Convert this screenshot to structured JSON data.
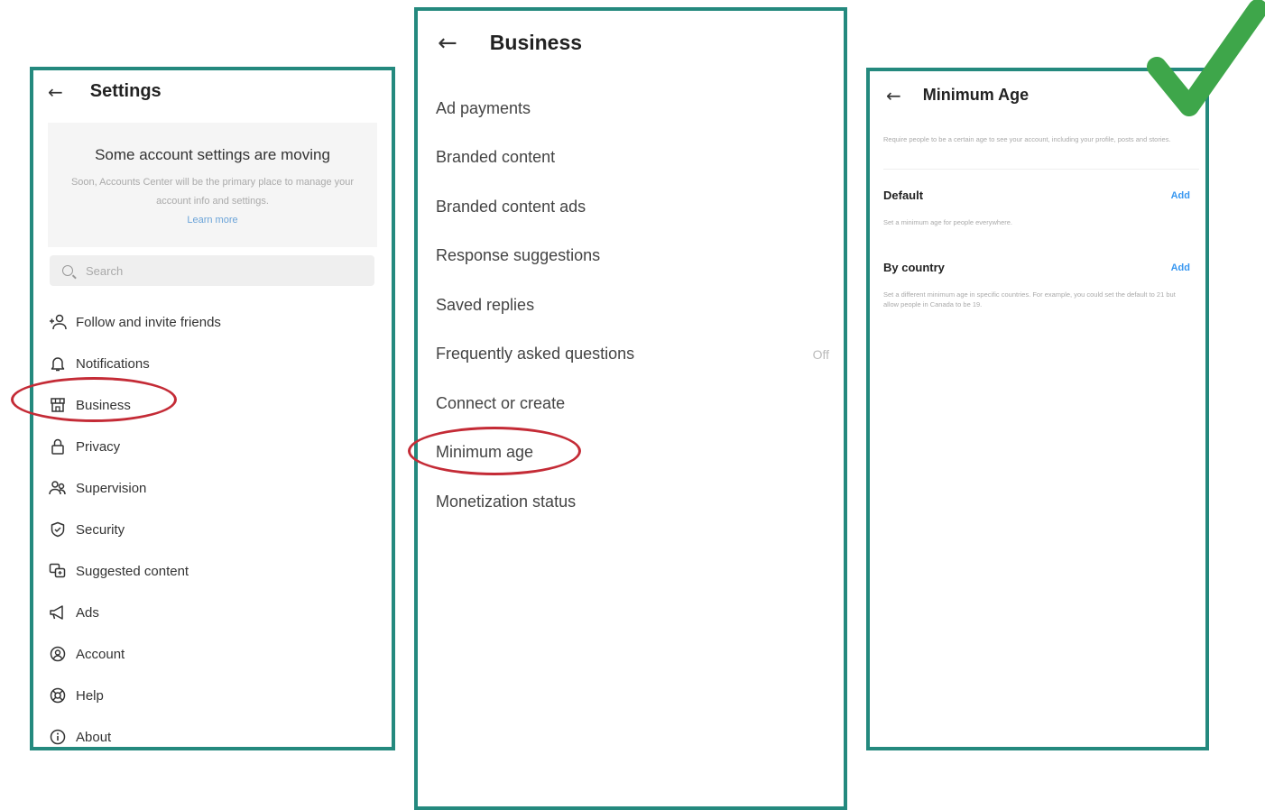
{
  "settings": {
    "title": "Settings",
    "notice": {
      "title": "Some account settings are moving",
      "body": "Soon, Accounts Center will be the primary place to manage your account info and settings.",
      "link": "Learn more"
    },
    "search_placeholder": "Search",
    "items": [
      {
        "label": "Follow and invite friends",
        "icon": "add-person-icon"
      },
      {
        "label": "Notifications",
        "icon": "bell-icon"
      },
      {
        "label": "Business",
        "icon": "store-icon"
      },
      {
        "label": "Privacy",
        "icon": "lock-icon"
      },
      {
        "label": "Supervision",
        "icon": "people-icon"
      },
      {
        "label": "Security",
        "icon": "shield-icon"
      },
      {
        "label": "Suggested content",
        "icon": "suggested-content-icon"
      },
      {
        "label": "Ads",
        "icon": "megaphone-icon"
      },
      {
        "label": "Account",
        "icon": "account-icon"
      },
      {
        "label": "Help",
        "icon": "lifebuoy-icon"
      },
      {
        "label": "About",
        "icon": "info-icon"
      }
    ]
  },
  "business": {
    "title": "Business",
    "items": [
      {
        "label": "Ad payments",
        "value": ""
      },
      {
        "label": "Branded content",
        "value": ""
      },
      {
        "label": "Branded content ads",
        "value": ""
      },
      {
        "label": "Response suggestions",
        "value": ""
      },
      {
        "label": "Saved replies",
        "value": ""
      },
      {
        "label": "Frequently asked questions",
        "value": "Off"
      },
      {
        "label": "Connect or create",
        "value": ""
      },
      {
        "label": "Minimum age",
        "value": ""
      },
      {
        "label": "Monetization status",
        "value": ""
      }
    ]
  },
  "minimum_age": {
    "title": "Minimum Age",
    "intro": "Require people to be a certain age to see your account, including your profile, posts and stories.",
    "sections": [
      {
        "title": "Default",
        "action": "Add",
        "desc": "Set a minimum age for people everywhere."
      },
      {
        "title": "By country",
        "action": "Add",
        "desc": "Set a different minimum age in specific countries. For example, you could set the default to 21 but allow people in Canada to be 19."
      }
    ]
  },
  "colors": {
    "panel_border": "#24897e",
    "highlight_ellipse": "#c42b36",
    "checkmark": "#3ea64a",
    "link_blue": "#3897f0"
  }
}
